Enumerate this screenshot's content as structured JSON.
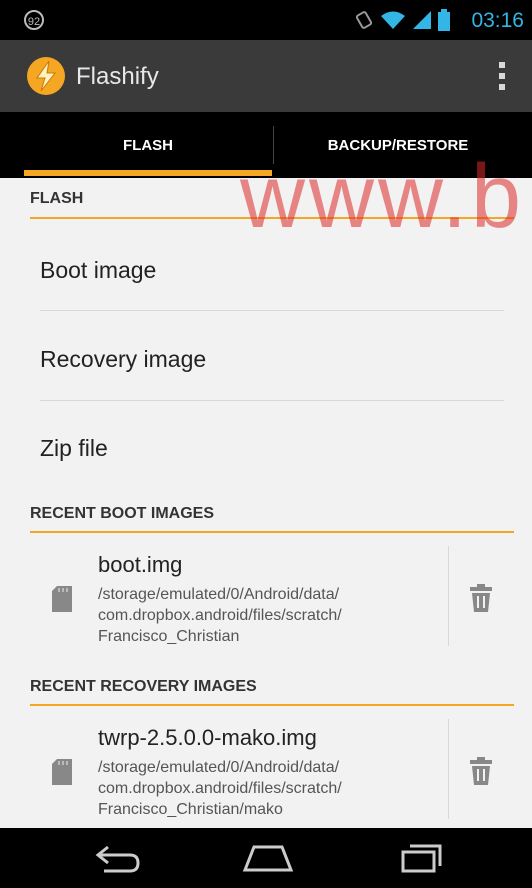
{
  "status_bar": {
    "notification_badge": "92",
    "time": "03:16"
  },
  "action_bar": {
    "title": "Flashify",
    "icon": "lightning-bolt-icon"
  },
  "tabs": [
    {
      "label": "FLASH",
      "selected": true
    },
    {
      "label": "BACKUP/RESTORE",
      "selected": false
    }
  ],
  "flash_section": {
    "header": "FLASH",
    "items": [
      "Boot image",
      "Recovery image",
      "Zip file"
    ]
  },
  "recent_boot": {
    "header": "RECENT BOOT IMAGES",
    "file": {
      "name": "boot.img",
      "path_lines": [
        "/storage/emulated/0/Android/data/",
        "com.dropbox.android/files/scratch/",
        "Francisco_Christian"
      ]
    }
  },
  "recent_recovery": {
    "header": "RECENT RECOVERY IMAGES",
    "file": {
      "name": "twrp-2.5.0.0-mako.img",
      "path_lines": [
        "/storage/emulated/0/Android/data/",
        "com.dropbox.android/files/scratch/",
        "Francisco_Christian/mako"
      ]
    }
  },
  "watermark": "www.b",
  "colors": {
    "accent": "#f5a623",
    "holo_blue": "#33b5e5",
    "actionbar": "#3a3a3a"
  }
}
